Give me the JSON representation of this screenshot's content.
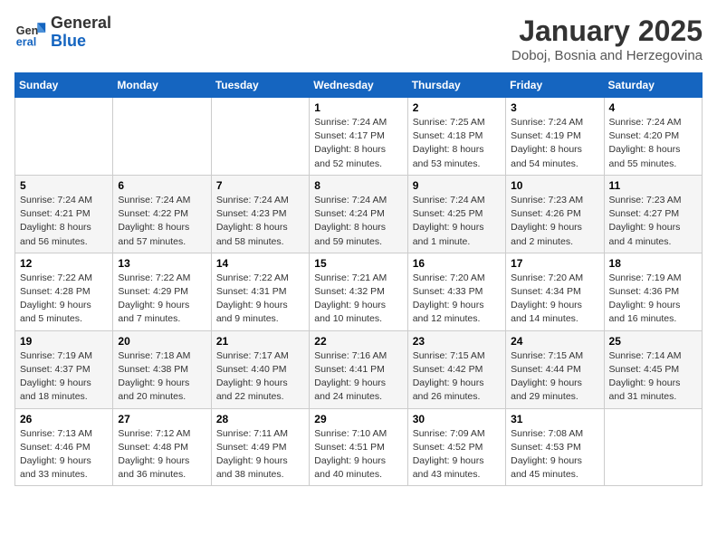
{
  "header": {
    "logo_general": "General",
    "logo_blue": "Blue",
    "month": "January 2025",
    "location": "Doboj, Bosnia and Herzegovina"
  },
  "weekdays": [
    "Sunday",
    "Monday",
    "Tuesday",
    "Wednesday",
    "Thursday",
    "Friday",
    "Saturday"
  ],
  "weeks": [
    [
      {
        "day": "",
        "info": ""
      },
      {
        "day": "",
        "info": ""
      },
      {
        "day": "",
        "info": ""
      },
      {
        "day": "1",
        "info": "Sunrise: 7:24 AM\nSunset: 4:17 PM\nDaylight: 8 hours and 52 minutes."
      },
      {
        "day": "2",
        "info": "Sunrise: 7:25 AM\nSunset: 4:18 PM\nDaylight: 8 hours and 53 minutes."
      },
      {
        "day": "3",
        "info": "Sunrise: 7:24 AM\nSunset: 4:19 PM\nDaylight: 8 hours and 54 minutes."
      },
      {
        "day": "4",
        "info": "Sunrise: 7:24 AM\nSunset: 4:20 PM\nDaylight: 8 hours and 55 minutes."
      }
    ],
    [
      {
        "day": "5",
        "info": "Sunrise: 7:24 AM\nSunset: 4:21 PM\nDaylight: 8 hours and 56 minutes."
      },
      {
        "day": "6",
        "info": "Sunrise: 7:24 AM\nSunset: 4:22 PM\nDaylight: 8 hours and 57 minutes."
      },
      {
        "day": "7",
        "info": "Sunrise: 7:24 AM\nSunset: 4:23 PM\nDaylight: 8 hours and 58 minutes."
      },
      {
        "day": "8",
        "info": "Sunrise: 7:24 AM\nSunset: 4:24 PM\nDaylight: 8 hours and 59 minutes."
      },
      {
        "day": "9",
        "info": "Sunrise: 7:24 AM\nSunset: 4:25 PM\nDaylight: 9 hours and 1 minute."
      },
      {
        "day": "10",
        "info": "Sunrise: 7:23 AM\nSunset: 4:26 PM\nDaylight: 9 hours and 2 minutes."
      },
      {
        "day": "11",
        "info": "Sunrise: 7:23 AM\nSunset: 4:27 PM\nDaylight: 9 hours and 4 minutes."
      }
    ],
    [
      {
        "day": "12",
        "info": "Sunrise: 7:22 AM\nSunset: 4:28 PM\nDaylight: 9 hours and 5 minutes."
      },
      {
        "day": "13",
        "info": "Sunrise: 7:22 AM\nSunset: 4:29 PM\nDaylight: 9 hours and 7 minutes."
      },
      {
        "day": "14",
        "info": "Sunrise: 7:22 AM\nSunset: 4:31 PM\nDaylight: 9 hours and 9 minutes."
      },
      {
        "day": "15",
        "info": "Sunrise: 7:21 AM\nSunset: 4:32 PM\nDaylight: 9 hours and 10 minutes."
      },
      {
        "day": "16",
        "info": "Sunrise: 7:20 AM\nSunset: 4:33 PM\nDaylight: 9 hours and 12 minutes."
      },
      {
        "day": "17",
        "info": "Sunrise: 7:20 AM\nSunset: 4:34 PM\nDaylight: 9 hours and 14 minutes."
      },
      {
        "day": "18",
        "info": "Sunrise: 7:19 AM\nSunset: 4:36 PM\nDaylight: 9 hours and 16 minutes."
      }
    ],
    [
      {
        "day": "19",
        "info": "Sunrise: 7:19 AM\nSunset: 4:37 PM\nDaylight: 9 hours and 18 minutes."
      },
      {
        "day": "20",
        "info": "Sunrise: 7:18 AM\nSunset: 4:38 PM\nDaylight: 9 hours and 20 minutes."
      },
      {
        "day": "21",
        "info": "Sunrise: 7:17 AM\nSunset: 4:40 PM\nDaylight: 9 hours and 22 minutes."
      },
      {
        "day": "22",
        "info": "Sunrise: 7:16 AM\nSunset: 4:41 PM\nDaylight: 9 hours and 24 minutes."
      },
      {
        "day": "23",
        "info": "Sunrise: 7:15 AM\nSunset: 4:42 PM\nDaylight: 9 hours and 26 minutes."
      },
      {
        "day": "24",
        "info": "Sunrise: 7:15 AM\nSunset: 4:44 PM\nDaylight: 9 hours and 29 minutes."
      },
      {
        "day": "25",
        "info": "Sunrise: 7:14 AM\nSunset: 4:45 PM\nDaylight: 9 hours and 31 minutes."
      }
    ],
    [
      {
        "day": "26",
        "info": "Sunrise: 7:13 AM\nSunset: 4:46 PM\nDaylight: 9 hours and 33 minutes."
      },
      {
        "day": "27",
        "info": "Sunrise: 7:12 AM\nSunset: 4:48 PM\nDaylight: 9 hours and 36 minutes."
      },
      {
        "day": "28",
        "info": "Sunrise: 7:11 AM\nSunset: 4:49 PM\nDaylight: 9 hours and 38 minutes."
      },
      {
        "day": "29",
        "info": "Sunrise: 7:10 AM\nSunset: 4:51 PM\nDaylight: 9 hours and 40 minutes."
      },
      {
        "day": "30",
        "info": "Sunrise: 7:09 AM\nSunset: 4:52 PM\nDaylight: 9 hours and 43 minutes."
      },
      {
        "day": "31",
        "info": "Sunrise: 7:08 AM\nSunset: 4:53 PM\nDaylight: 9 hours and 45 minutes."
      },
      {
        "day": "",
        "info": ""
      }
    ]
  ]
}
